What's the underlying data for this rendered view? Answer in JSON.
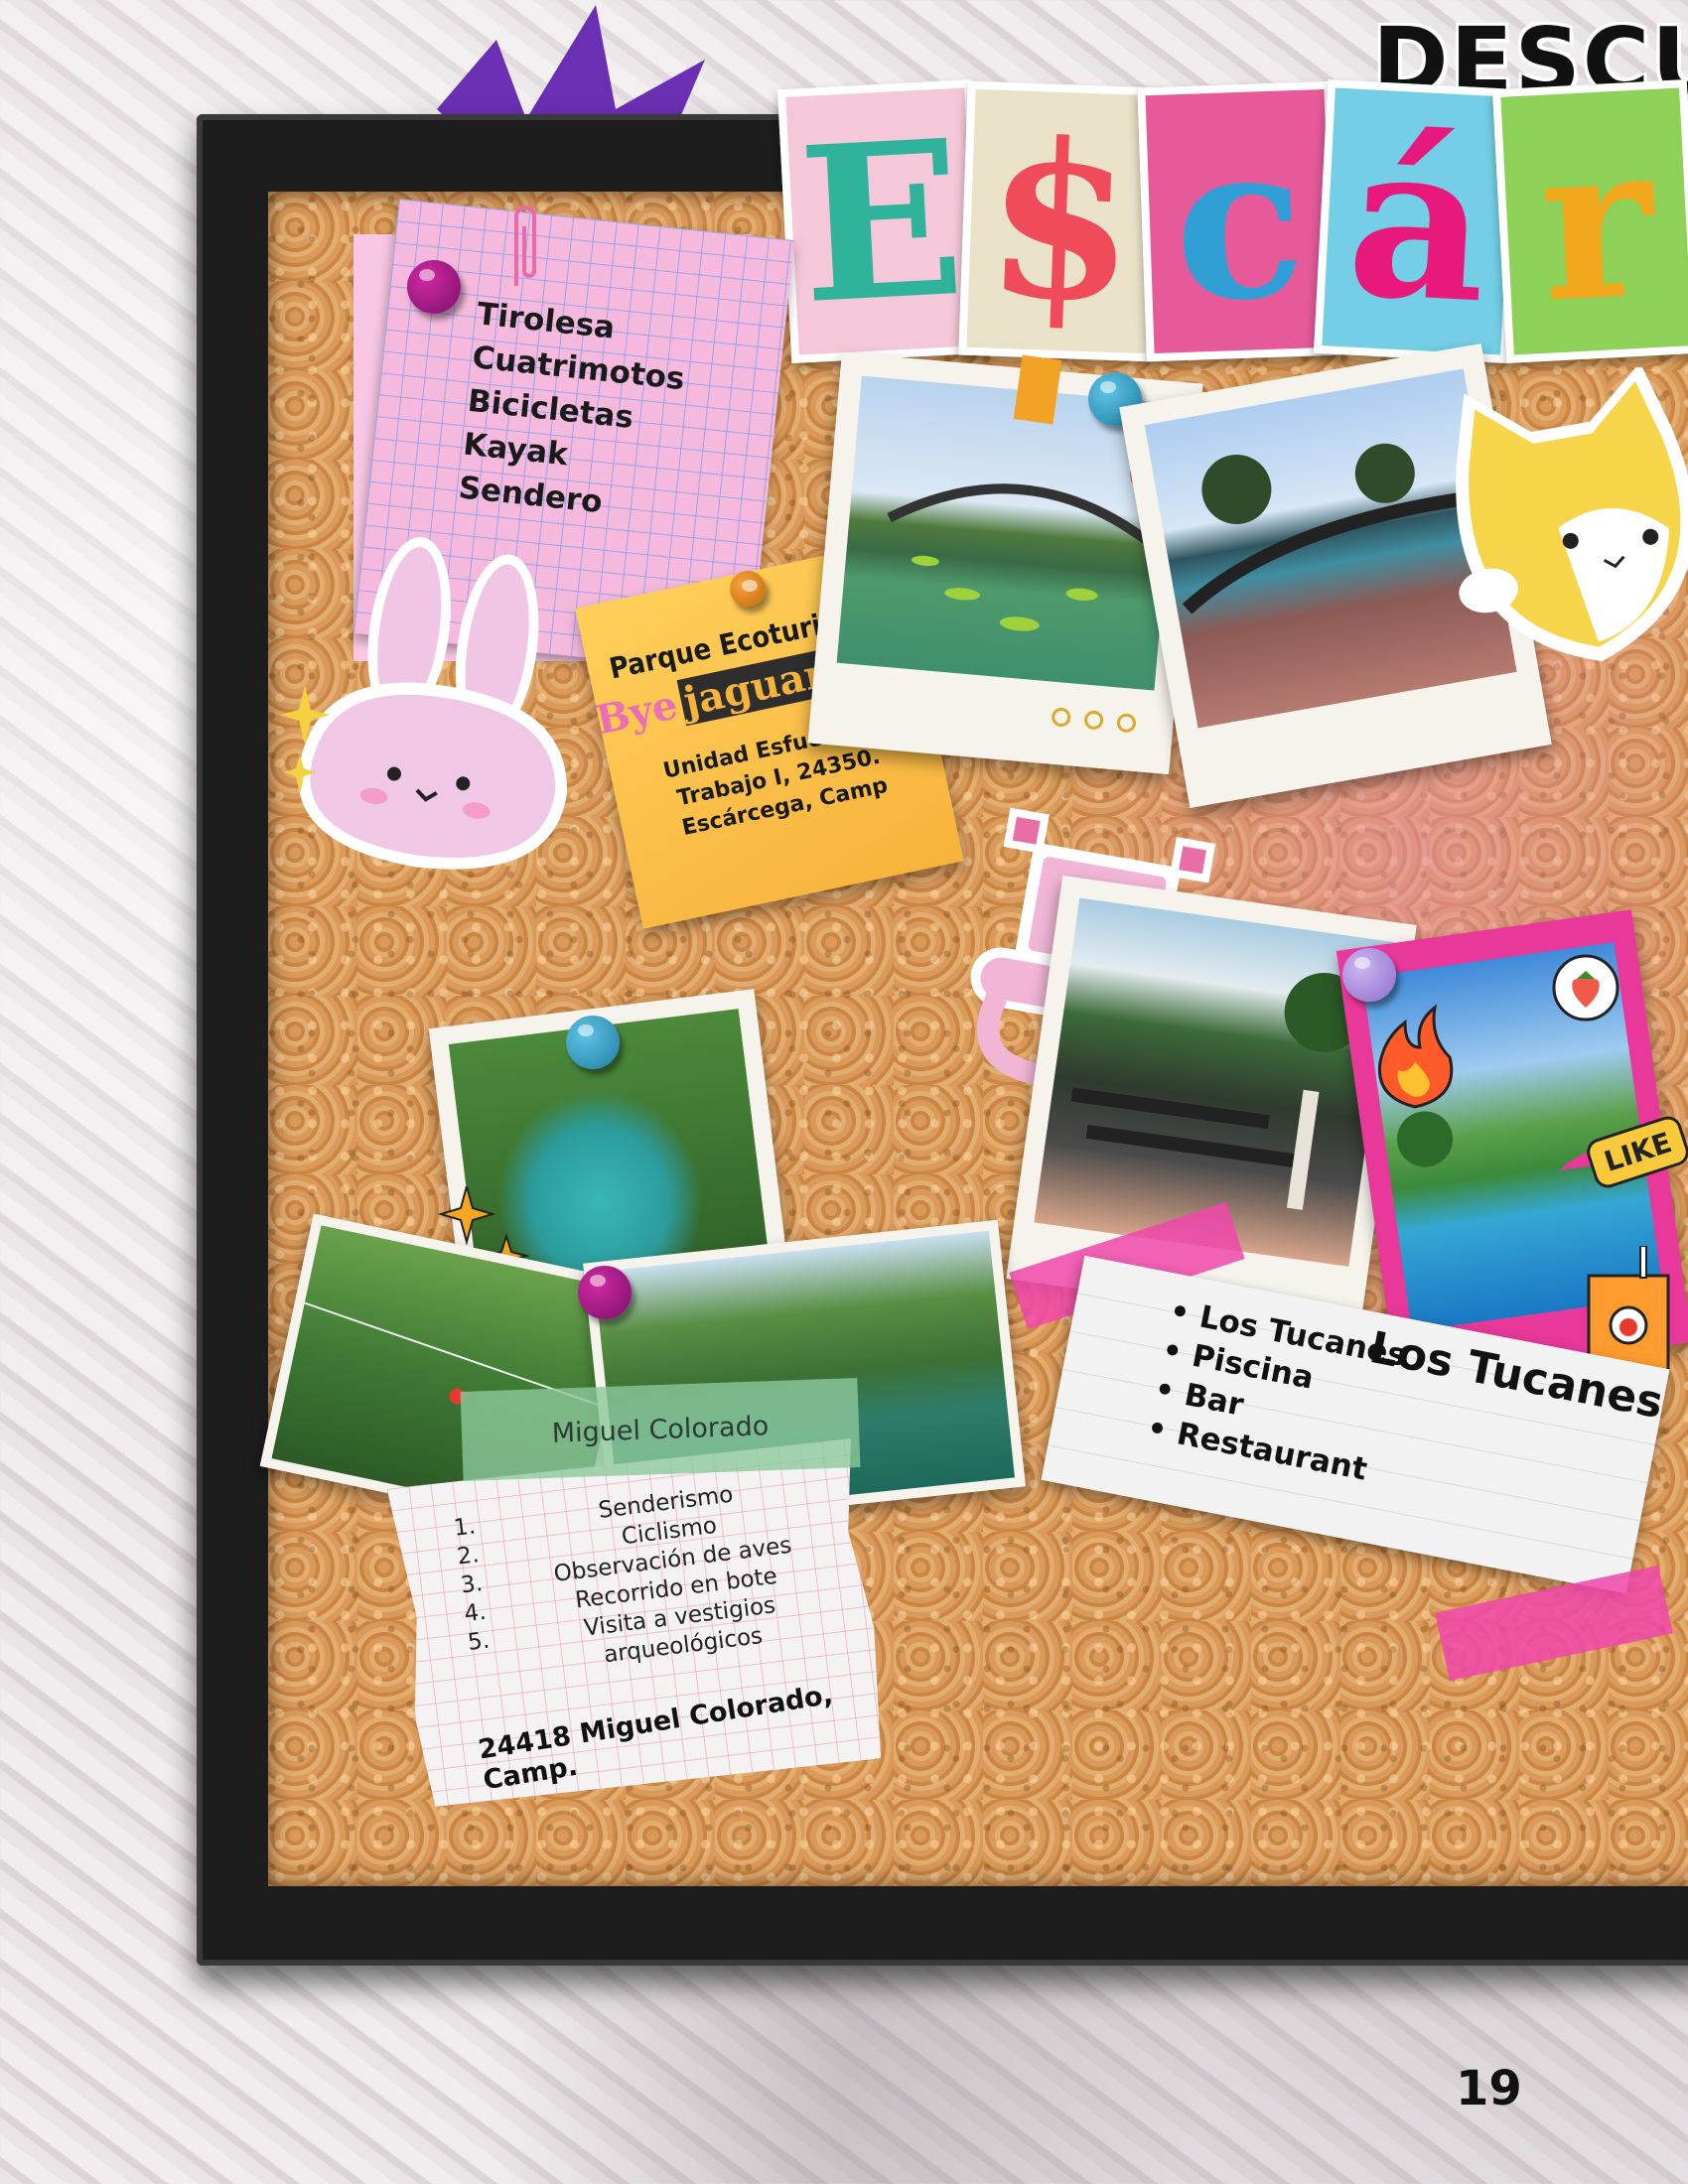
{
  "page": {
    "header_text": "DESCU",
    "page_number": "19"
  },
  "title": {
    "letters": [
      {
        "char": "E",
        "color": "#2fb39a",
        "bg": "#f4c8d8"
      },
      {
        "char": "$",
        "color": "#ef4b5a",
        "bg": "#e9e2c8"
      },
      {
        "char": "c",
        "color": "#2f9fd6",
        "bg": "#e65a9a"
      },
      {
        "char": "á",
        "color": "#e8197d",
        "bg": "#74cfe6"
      },
      {
        "char": "r",
        "color": "#f2a81d",
        "bg": "#8ed158"
      }
    ]
  },
  "pink_note": {
    "items": [
      "Tirolesa",
      "Cuatrimotos",
      "Bicicletas",
      "Kayak",
      "Sendero"
    ]
  },
  "sticky_note": {
    "title": "Parque Ecoturistico",
    "brand_parts": [
      "Bye",
      "jaguar"
    ],
    "address_lines": [
      "Unidad Esfuerzo y",
      "Trabajo I, 24350.",
      "Escárcega, Camp"
    ]
  },
  "miguel_colorado": {
    "banner": "Miguel Colorado",
    "activities": [
      {
        "num": "1.",
        "text": "Senderismo"
      },
      {
        "num": "2.",
        "text": "Ciclismo"
      },
      {
        "num": "3.",
        "text": "Observación de aves"
      },
      {
        "num": "4.",
        "text": "Recorrido en bote"
      },
      {
        "num": "5.",
        "text": "Visita a vestigios arqueológicos"
      }
    ],
    "address": "24418 Miguel Colorado, Camp."
  },
  "los_tucanes": {
    "title": "Los Tucanes",
    "items": [
      "Los Tucanes",
      "Piscina",
      "Bar",
      "Restaurant"
    ]
  },
  "stickers": {
    "like_badge": "LIKE"
  },
  "icons": [
    "bunny-sticker-icon",
    "cat-sticker-icon",
    "axolotl-sticker-icon",
    "heart-bubble-icon",
    "flame-icon",
    "juice-box-icon",
    "strawberry-icon",
    "sparkle-icon",
    "paperclip-icon"
  ]
}
